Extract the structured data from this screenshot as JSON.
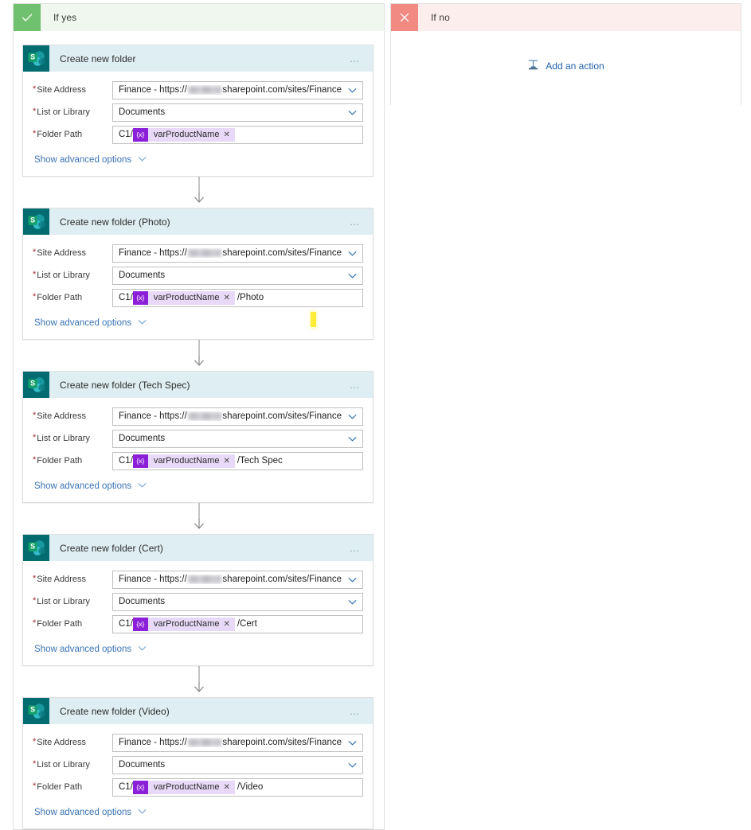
{
  "branches": {
    "yes": {
      "label": "If yes",
      "badge_icon": "checkmark-icon",
      "accent": "#6fc06f",
      "header_bg": "#eff7ef"
    },
    "no": {
      "label": "If no",
      "badge_icon": "close-x-icon",
      "accent": "#f08a82",
      "header_bg": "#fdeeee",
      "add_action_label": "Add an action",
      "add_action_icon": "insert-step-icon"
    }
  },
  "common": {
    "connector_icon": "down-arrow-icon",
    "card_menu_icon": "ellipsis-icon",
    "card_icon": "sharepoint-icon",
    "advanced_label": "Show advanced options",
    "advanced_chevron_icon": "chevron-down-icon",
    "dropdown_chevron_icon": "chevron-down-icon",
    "token_badge_text": "{x}",
    "token_remove_icon": "remove-token-x-icon",
    "required_marker": "*",
    "labels": {
      "site_address": "Site Address",
      "list_or_library": "List or Library",
      "folder_path": "Folder Path"
    },
    "values": {
      "site_address_prefix": "Finance - https://",
      "site_address_suffix": "sharepoint.com/sites/Finance",
      "site_address_redacted": true,
      "list_or_library": "Documents",
      "folder_path_prefix": "C1/",
      "folder_path_token": "varProductName"
    }
  },
  "cards": [
    {
      "title": "Create new folder",
      "folder_path_suffix": ""
    },
    {
      "title": "Create new folder (Photo)",
      "folder_path_suffix": "/Photo"
    },
    {
      "title": "Create new folder (Tech Spec)",
      "folder_path_suffix": "/Tech Spec"
    },
    {
      "title": "Create new folder (Cert)",
      "folder_path_suffix": "/Cert"
    },
    {
      "title": "Create new folder (Video)",
      "folder_path_suffix": "/Video"
    }
  ],
  "annotation": {
    "marker_color": "#ffe500"
  }
}
